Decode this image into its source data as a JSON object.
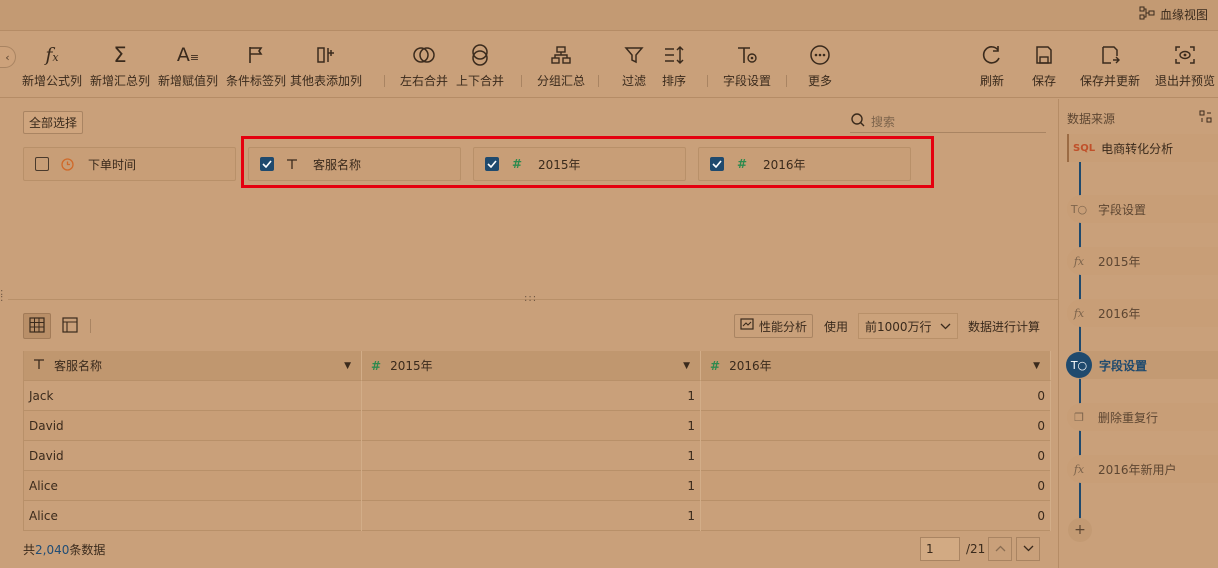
{
  "topbar": {
    "lineage_label": "血缘视图"
  },
  "toolbar": {
    "tools": [
      {
        "label": "新增公式列",
        "icon": "formula-icon"
      },
      {
        "label": "新增汇总列",
        "icon": "sum-icon"
      },
      {
        "label": "新增赋值列",
        "icon": "assign-icon"
      },
      {
        "label": "条件标签列",
        "icon": "flag-icon"
      },
      {
        "label": "其他表添加列",
        "icon": "add-column-icon"
      },
      {
        "label": "左右合并",
        "icon": "merge-horizontal-icon"
      },
      {
        "label": "上下合并",
        "icon": "merge-vertical-icon"
      },
      {
        "label": "分组汇总",
        "icon": "group-icon"
      },
      {
        "label": "过滤",
        "icon": "filter-icon"
      },
      {
        "label": "排序",
        "icon": "sort-icon"
      },
      {
        "label": "字段设置",
        "icon": "field-settings-icon"
      },
      {
        "label": "更多",
        "icon": "more-icon"
      },
      {
        "label": "刷新",
        "icon": "refresh-icon"
      },
      {
        "label": "保存",
        "icon": "save-icon"
      },
      {
        "label": "保存并更新",
        "icon": "save-update-icon"
      },
      {
        "label": "退出并预览",
        "icon": "exit-preview-icon"
      }
    ]
  },
  "fields": {
    "select_all_label": "全部选择",
    "search_placeholder": "搜索",
    "items": [
      {
        "name": "下单时间",
        "checked": false,
        "type": "date"
      },
      {
        "name": "客服名称",
        "checked": true,
        "type": "text"
      },
      {
        "name": "2015年",
        "checked": true,
        "type": "number"
      },
      {
        "name": "2016年",
        "checked": true,
        "type": "number"
      }
    ]
  },
  "preview": {
    "perf_label": "性能分析",
    "use_label": "使用",
    "rows_option": "前1000万行",
    "calc_label": "数据进行计算",
    "columns": [
      {
        "name": "客服名称",
        "type": "text"
      },
      {
        "name": "2015年",
        "type": "number"
      },
      {
        "name": "2016年",
        "type": "number"
      }
    ],
    "rows": [
      [
        "Jack",
        "1",
        "0"
      ],
      [
        "David",
        "1",
        "0"
      ],
      [
        "David",
        "1",
        "0"
      ],
      [
        "Alice",
        "1",
        "0"
      ],
      [
        "Alice",
        "1",
        "0"
      ]
    ],
    "total_prefix": "共",
    "total_count": "2,040",
    "total_suffix": "条数据",
    "page_current": "1",
    "page_total": "/21"
  },
  "sidebar": {
    "title": "数据来源",
    "source_name": "电商转化分析",
    "steps": [
      {
        "label": "字段设置",
        "icon": "T",
        "active": false
      },
      {
        "label": "2015年",
        "icon": "fx",
        "active": false
      },
      {
        "label": "2016年",
        "icon": "fx",
        "active": false
      },
      {
        "label": "字段设置",
        "icon": "T",
        "active": true
      },
      {
        "label": "删除重复行",
        "icon": "dup",
        "active": false
      },
      {
        "label": "2016年新用户",
        "icon": "fx",
        "active": false
      }
    ],
    "add_label": "+"
  },
  "colors": {
    "accent": "#1f4a6e",
    "highlight": "#e5000f",
    "number_icon": "#2e8a4e",
    "date_icon": "#d06a2a"
  }
}
